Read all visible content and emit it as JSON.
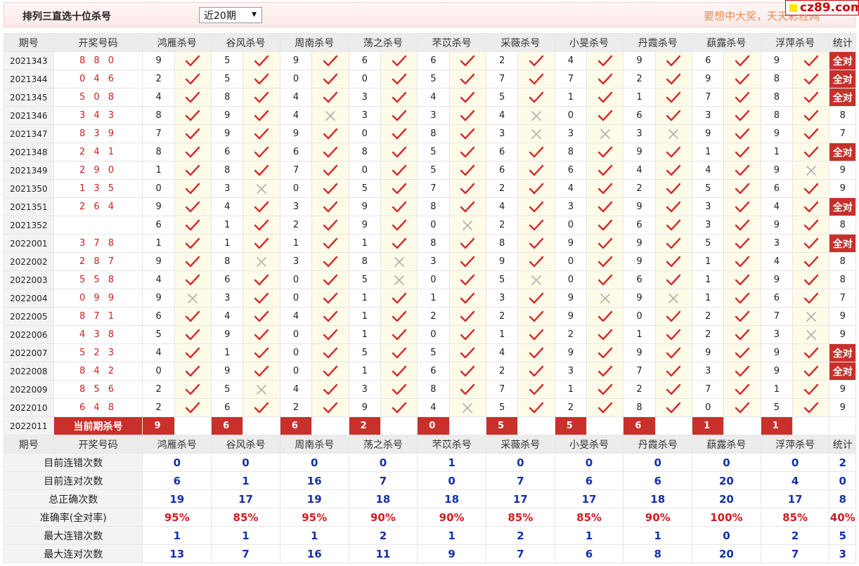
{
  "header": {
    "title": "排列三直选十位杀号",
    "period_select": "近20期",
    "marquee": "要想中大奖，天天彩经网",
    "site_badge": "cz89.com"
  },
  "columns": {
    "period": "期号",
    "draw": "开奖号码",
    "experts": [
      "鸿雁杀号",
      "谷风杀号",
      "周南杀号",
      "荡之杀号",
      "芣苡杀号",
      "采薇杀号",
      "小旻杀号",
      "丹霞杀号",
      "蕻露杀号",
      "浮萍杀号"
    ],
    "stat": "统计"
  },
  "rows": [
    {
      "period": "2021343",
      "draw": "8 8 0",
      "nums": [
        "9",
        "5",
        "9",
        "6",
        "6",
        "2",
        "4",
        "9",
        "6",
        "9"
      ],
      "marks": "1111111111",
      "stat": "全对"
    },
    {
      "period": "2021344",
      "draw": "0 4 6",
      "nums": [
        "2",
        "5",
        "0",
        "0",
        "5",
        "7",
        "7",
        "2",
        "9",
        "8"
      ],
      "marks": "1111111111",
      "stat": "全对"
    },
    {
      "period": "2021345",
      "draw": "5 0 8",
      "nums": [
        "4",
        "8",
        "4",
        "3",
        "4",
        "5",
        "1",
        "1",
        "7",
        "8"
      ],
      "marks": "1111111111",
      "stat": "全对"
    },
    {
      "period": "2021346",
      "draw": "3 4 3",
      "nums": [
        "8",
        "9",
        "4",
        "3",
        "3",
        "4",
        "0",
        "6",
        "3",
        "8"
      ],
      "marks": "1101101111",
      "stat": "8"
    },
    {
      "period": "2021347",
      "draw": "8 3 9",
      "nums": [
        "7",
        "9",
        "9",
        "0",
        "8",
        "3",
        "3",
        "3",
        "9",
        "9"
      ],
      "marks": "1111100011",
      "stat": "7"
    },
    {
      "period": "2021348",
      "draw": "2 4 1",
      "nums": [
        "8",
        "6",
        "6",
        "8",
        "5",
        "6",
        "8",
        "9",
        "1",
        "1"
      ],
      "marks": "1111111111",
      "stat": "全对"
    },
    {
      "period": "2021349",
      "draw": "2 9 0",
      "nums": [
        "1",
        "8",
        "7",
        "0",
        "5",
        "6",
        "6",
        "4",
        "4",
        "9"
      ],
      "marks": "1111111110",
      "stat": "9"
    },
    {
      "period": "2021350",
      "draw": "1 3 5",
      "nums": [
        "0",
        "3",
        "0",
        "5",
        "7",
        "2",
        "4",
        "2",
        "5",
        "6"
      ],
      "marks": "1011111111",
      "stat": "9"
    },
    {
      "period": "2021351",
      "draw": "2 6 4",
      "nums": [
        "9",
        "4",
        "3",
        "9",
        "8",
        "4",
        "3",
        "9",
        "3",
        "4"
      ],
      "marks": "1111111111",
      "stat": "全对"
    },
    {
      "period": "2021352",
      "draw": "",
      "nums": [
        "6",
        "1",
        "2",
        "9",
        "0",
        "2",
        "0",
        "6",
        "3",
        "9"
      ],
      "marks": "1111011111",
      "stat": "8"
    },
    {
      "period": "2022001",
      "draw": "3 7 8",
      "nums": [
        "1",
        "1",
        "1",
        "1",
        "8",
        "8",
        "9",
        "9",
        "5",
        "3"
      ],
      "marks": "1111111111",
      "stat": "全对"
    },
    {
      "period": "2022002",
      "draw": "2 8 7",
      "nums": [
        "9",
        "8",
        "3",
        "8",
        "3",
        "9",
        "0",
        "9",
        "1",
        "4"
      ],
      "marks": "1010111111",
      "stat": "8"
    },
    {
      "period": "2022003",
      "draw": "5 5 8",
      "nums": [
        "4",
        "6",
        "0",
        "5",
        "0",
        "5",
        "0",
        "6",
        "1",
        "9"
      ],
      "marks": "1110101111",
      "stat": "8"
    },
    {
      "period": "2022004",
      "draw": "0 9 9",
      "nums": [
        "9",
        "3",
        "0",
        "1",
        "1",
        "3",
        "9",
        "9",
        "1",
        "6"
      ],
      "marks": "0111110011",
      "stat": "7"
    },
    {
      "period": "2022005",
      "draw": "8 7 1",
      "nums": [
        "6",
        "4",
        "4",
        "1",
        "2",
        "2",
        "9",
        "0",
        "2",
        "7"
      ],
      "marks": "1111111110",
      "stat": "9"
    },
    {
      "period": "2022006",
      "draw": "4 3 8",
      "nums": [
        "5",
        "9",
        "0",
        "1",
        "0",
        "1",
        "2",
        "1",
        "2",
        "3"
      ],
      "marks": "1111111110",
      "stat": "9"
    },
    {
      "period": "2022007",
      "draw": "5 2 3",
      "nums": [
        "4",
        "1",
        "0",
        "5",
        "5",
        "4",
        "9",
        "9",
        "9",
        "9"
      ],
      "marks": "1111111111",
      "stat": "全对"
    },
    {
      "period": "2022008",
      "draw": "8 4 2",
      "nums": [
        "0",
        "9",
        "0",
        "1",
        "6",
        "2",
        "3",
        "7",
        "3",
        "9"
      ],
      "marks": "1111111111",
      "stat": "全对"
    },
    {
      "period": "2022009",
      "draw": "8 5 6",
      "nums": [
        "2",
        "5",
        "4",
        "3",
        "8",
        "7",
        "1",
        "2",
        "7",
        "1"
      ],
      "marks": "1011111111",
      "stat": "9"
    },
    {
      "period": "2022010",
      "draw": "6 4 8",
      "nums": [
        "2",
        "6",
        "2",
        "9",
        "4",
        "5",
        "2",
        "8",
        "0",
        "5"
      ],
      "marks": "1111011111",
      "stat": "9"
    }
  ],
  "current": {
    "period": "2022011",
    "label": "当前期杀号",
    "nums": [
      "9",
      "6",
      "6",
      "2",
      "0",
      "5",
      "5",
      "6",
      "1",
      "1"
    ]
  },
  "summary": [
    {
      "label": "目前连错次数",
      "values": [
        "0",
        "0",
        "0",
        "0",
        "1",
        "0",
        "0",
        "0",
        "0",
        "0"
      ],
      "stat": "2",
      "kind": "num"
    },
    {
      "label": "目前连对次数",
      "values": [
        "6",
        "1",
        "16",
        "7",
        "0",
        "7",
        "6",
        "6",
        "20",
        "4"
      ],
      "stat": "0",
      "kind": "num"
    },
    {
      "label": "总正确次数",
      "values": [
        "19",
        "17",
        "19",
        "18",
        "18",
        "17",
        "17",
        "18",
        "20",
        "17"
      ],
      "stat": "8",
      "kind": "num"
    },
    {
      "label": "准确率(全对率)",
      "values": [
        "95%",
        "85%",
        "95%",
        "90%",
        "90%",
        "85%",
        "85%",
        "90%",
        "100%",
        "85%"
      ],
      "stat": "40%",
      "kind": "rate"
    },
    {
      "label": "最大连错次数",
      "values": [
        "1",
        "1",
        "1",
        "2",
        "1",
        "2",
        "1",
        "1",
        "0",
        "2"
      ],
      "stat": "5",
      "kind": "num"
    },
    {
      "label": "最大连对次数",
      "values": [
        "13",
        "7",
        "16",
        "11",
        "9",
        "7",
        "6",
        "8",
        "20",
        "7"
      ],
      "stat": "3",
      "kind": "num"
    }
  ],
  "colors": {
    "accent_red": "#c8302b",
    "check_red": "#d42b2b",
    "cross_gray": "#aaaaaa",
    "value_blue": "#1530a8"
  },
  "icons": {
    "correct": "check-mark-icon",
    "wrong": "cross-mark-icon",
    "dropdown": "chevron-down-icon"
  }
}
